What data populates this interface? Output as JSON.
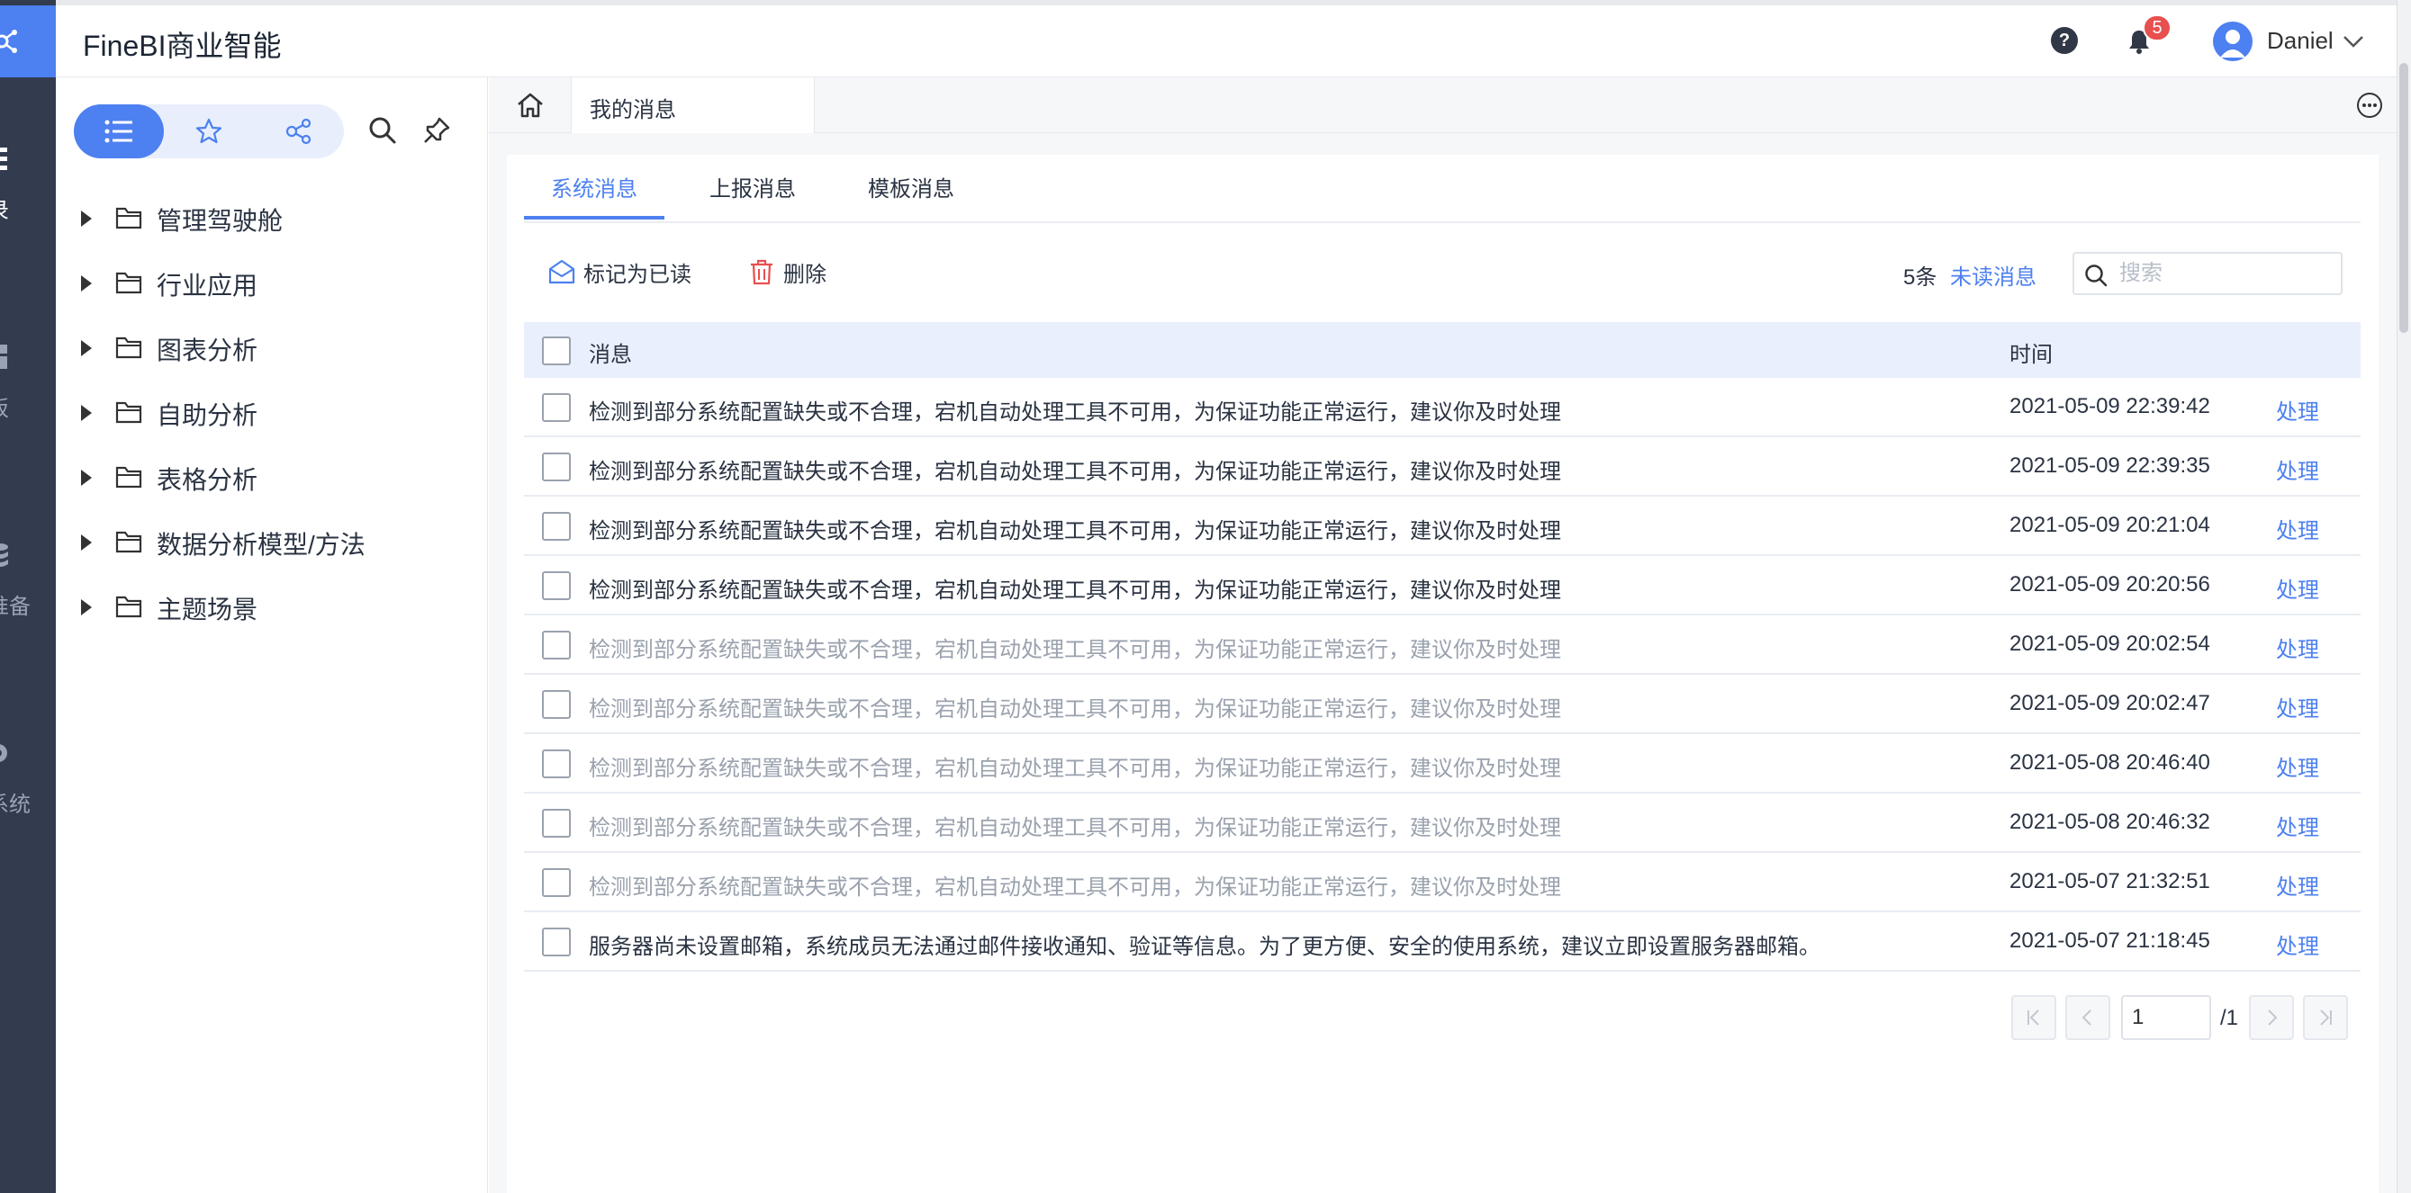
{
  "app": {
    "title": "FineBI商业智能"
  },
  "rail": {
    "items": [
      {
        "label": "录",
        "icon": "directory-icon"
      },
      {
        "label": "板",
        "icon": "dashboard-icon"
      },
      {
        "label": "准备",
        "icon": "data-prep-icon"
      },
      {
        "label": "系统",
        "icon": "system-gear-icon"
      }
    ]
  },
  "header": {
    "notification_count": "5",
    "user_name": "Daniel"
  },
  "sidebar": {
    "tree": [
      {
        "label": "管理驾驶舱"
      },
      {
        "label": "行业应用"
      },
      {
        "label": "图表分析"
      },
      {
        "label": "自助分析"
      },
      {
        "label": "表格分析"
      },
      {
        "label": "数据分析模型/方法"
      },
      {
        "label": "主题场景"
      }
    ]
  },
  "tabbar": {
    "active_tab": "我的消息"
  },
  "content": {
    "tabs": [
      {
        "label": "系统消息",
        "active": true
      },
      {
        "label": "上报消息",
        "active": false
      },
      {
        "label": "模板消息",
        "active": false
      }
    ],
    "toolbar": {
      "mark_read_label": "标记为已读",
      "delete_label": "删除",
      "unread_count": "5条",
      "unread_link": "未读消息",
      "search_placeholder": "搜索"
    },
    "table": {
      "columns": [
        "消息",
        "时间"
      ],
      "rows": [
        {
          "message": "检测到部分系统配置缺失或不合理，宕机自动处理工具不可用，为保证功能正常运行，建议你及时处理",
          "time": "2021-05-09 22:39:42",
          "action": "处理",
          "read": false
        },
        {
          "message": "检测到部分系统配置缺失或不合理，宕机自动处理工具不可用，为保证功能正常运行，建议你及时处理",
          "time": "2021-05-09 22:39:35",
          "action": "处理",
          "read": false
        },
        {
          "message": "检测到部分系统配置缺失或不合理，宕机自动处理工具不可用，为保证功能正常运行，建议你及时处理",
          "time": "2021-05-09 20:21:04",
          "action": "处理",
          "read": false
        },
        {
          "message": "检测到部分系统配置缺失或不合理，宕机自动处理工具不可用，为保证功能正常运行，建议你及时处理",
          "time": "2021-05-09 20:20:56",
          "action": "处理",
          "read": false
        },
        {
          "message": "检测到部分系统配置缺失或不合理，宕机自动处理工具不可用，为保证功能正常运行，建议你及时处理",
          "time": "2021-05-09 20:02:54",
          "action": "处理",
          "read": true
        },
        {
          "message": "检测到部分系统配置缺失或不合理，宕机自动处理工具不可用，为保证功能正常运行，建议你及时处理",
          "time": "2021-05-09 20:02:47",
          "action": "处理",
          "read": true
        },
        {
          "message": "检测到部分系统配置缺失或不合理，宕机自动处理工具不可用，为保证功能正常运行，建议你及时处理",
          "time": "2021-05-08 20:46:40",
          "action": "处理",
          "read": true
        },
        {
          "message": "检测到部分系统配置缺失或不合理，宕机自动处理工具不可用，为保证功能正常运行，建议你及时处理",
          "time": "2021-05-08 20:46:32",
          "action": "处理",
          "read": true
        },
        {
          "message": "检测到部分系统配置缺失或不合理，宕机自动处理工具不可用，为保证功能正常运行，建议你及时处理",
          "time": "2021-05-07 21:32:51",
          "action": "处理",
          "read": true
        },
        {
          "message": "服务器尚未设置邮箱，系统成员无法通过邮件接收通知、验证等信息。为了更方便、安全的使用系统，建议立即设置服务器邮箱。",
          "time": "2021-05-07 21:18:45",
          "action": "处理",
          "read": false
        }
      ]
    },
    "pagination": {
      "current_page": "1",
      "total": "/1"
    }
  },
  "colors": {
    "accent": "#4d80f0",
    "rail_bg": "#333b4f",
    "badge": "#e84f4f",
    "read_text": "#9aa2ae"
  }
}
